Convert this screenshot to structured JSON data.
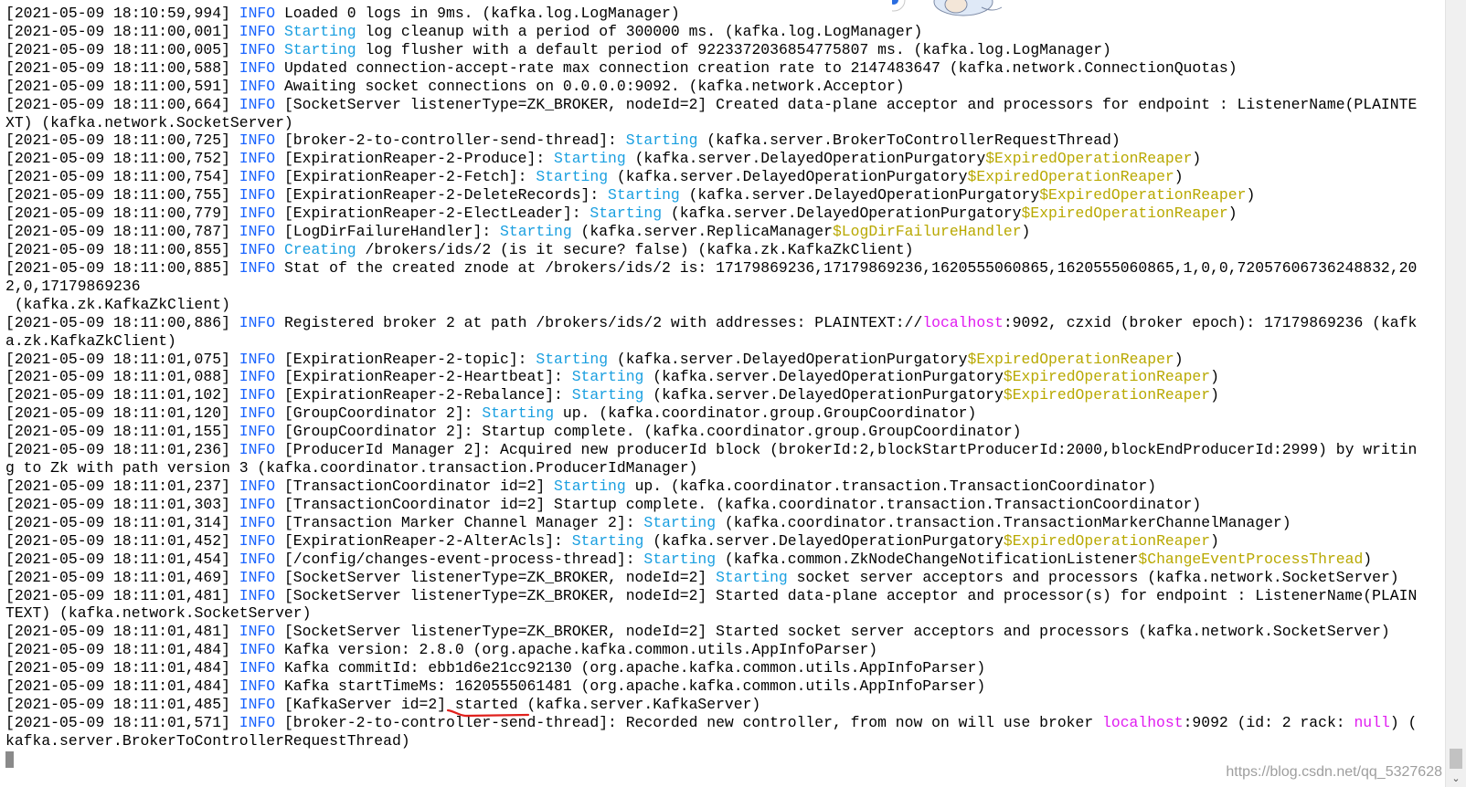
{
  "terminal": {
    "lines": [
      [
        {
          "t": "[2021-05-09 18:10:59,994] "
        },
        {
          "t": "INFO",
          "c": "info"
        },
        {
          "t": " Loaded 0 logs in 9ms. (kafka.log.LogManager)"
        }
      ],
      [
        {
          "t": "[2021-05-09 18:11:00,001] "
        },
        {
          "t": "INFO",
          "c": "info"
        },
        {
          "t": " "
        },
        {
          "t": "Starting",
          "c": "kw"
        },
        {
          "t": " log cleanup with a period of 300000 ms. (kafka.log.LogManager)"
        }
      ],
      [
        {
          "t": "[2021-05-09 18:11:00,005] "
        },
        {
          "t": "INFO",
          "c": "info"
        },
        {
          "t": " "
        },
        {
          "t": "Starting",
          "c": "kw"
        },
        {
          "t": " log flusher with a default period of 9223372036854775807 ms. (kafka.log.LogManager)"
        }
      ],
      [
        {
          "t": "[2021-05-09 18:11:00,588] "
        },
        {
          "t": "INFO",
          "c": "info"
        },
        {
          "t": " Updated connection-accept-rate max connection creation rate to 2147483647 (kafka.network.ConnectionQuotas)"
        }
      ],
      [
        {
          "t": "[2021-05-09 18:11:00,591] "
        },
        {
          "t": "INFO",
          "c": "info"
        },
        {
          "t": " Awaiting socket connections on 0.0.0.0:9092. (kafka.network.Acceptor)"
        }
      ],
      [
        {
          "t": "[2021-05-09 18:11:00,664] "
        },
        {
          "t": "INFO",
          "c": "info"
        },
        {
          "t": " [SocketServer listenerType=ZK_BROKER, nodeId=2] Created data-plane acceptor and processors for endpoint : ListenerName(PLAINTE"
        }
      ],
      [
        {
          "t": "XT) (kafka.network.SocketServer)"
        }
      ],
      [
        {
          "t": "[2021-05-09 18:11:00,725] "
        },
        {
          "t": "INFO",
          "c": "info"
        },
        {
          "t": " [broker-2-to-controller-send-thread]: "
        },
        {
          "t": "Starting",
          "c": "kw"
        },
        {
          "t": " (kafka.server.BrokerToControllerRequestThread)"
        }
      ],
      [
        {
          "t": "[2021-05-09 18:11:00,752] "
        },
        {
          "t": "INFO",
          "c": "info"
        },
        {
          "t": " [ExpirationReaper-2-Produce]: "
        },
        {
          "t": "Starting",
          "c": "kw"
        },
        {
          "t": " (kafka.server.DelayedOperationPurgatory"
        },
        {
          "t": "$ExpiredOperationReaper",
          "c": "hl"
        },
        {
          "t": ")"
        }
      ],
      [
        {
          "t": "[2021-05-09 18:11:00,754] "
        },
        {
          "t": "INFO",
          "c": "info"
        },
        {
          "t": " [ExpirationReaper-2-Fetch]: "
        },
        {
          "t": "Starting",
          "c": "kw"
        },
        {
          "t": " (kafka.server.DelayedOperationPurgatory"
        },
        {
          "t": "$ExpiredOperationReaper",
          "c": "hl"
        },
        {
          "t": ")"
        }
      ],
      [
        {
          "t": "[2021-05-09 18:11:00,755] "
        },
        {
          "t": "INFO",
          "c": "info"
        },
        {
          "t": " [ExpirationReaper-2-DeleteRecords]: "
        },
        {
          "t": "Starting",
          "c": "kw"
        },
        {
          "t": " (kafka.server.DelayedOperationPurgatory"
        },
        {
          "t": "$ExpiredOperationReaper",
          "c": "hl"
        },
        {
          "t": ")"
        }
      ],
      [
        {
          "t": "[2021-05-09 18:11:00,779] "
        },
        {
          "t": "INFO",
          "c": "info"
        },
        {
          "t": " [ExpirationReaper-2-ElectLeader]: "
        },
        {
          "t": "Starting",
          "c": "kw"
        },
        {
          "t": " (kafka.server.DelayedOperationPurgatory"
        },
        {
          "t": "$ExpiredOperationReaper",
          "c": "hl"
        },
        {
          "t": ")"
        }
      ],
      [
        {
          "t": "[2021-05-09 18:11:00,787] "
        },
        {
          "t": "INFO",
          "c": "info"
        },
        {
          "t": " [LogDirFailureHandler]: "
        },
        {
          "t": "Starting",
          "c": "kw"
        },
        {
          "t": " (kafka.server.ReplicaManager"
        },
        {
          "t": "$LogDirFailureHandler",
          "c": "hl"
        },
        {
          "t": ")"
        }
      ],
      [
        {
          "t": "[2021-05-09 18:11:00,855] "
        },
        {
          "t": "INFO",
          "c": "info"
        },
        {
          "t": " "
        },
        {
          "t": "Creating",
          "c": "kw"
        },
        {
          "t": " /brokers/ids/2 (is it secure? false) (kafka.zk.KafkaZkClient)"
        }
      ],
      [
        {
          "t": "[2021-05-09 18:11:00,885] "
        },
        {
          "t": "INFO",
          "c": "info"
        },
        {
          "t": " Stat of the created znode at /brokers/ids/2 is: 17179869236,17179869236,1620555060865,1620555060865,1,0,0,72057606736248832,20"
        }
      ],
      [
        {
          "t": "2,0,17179869236"
        }
      ],
      [
        {
          "t": " (kafka.zk.KafkaZkClient)"
        }
      ],
      [
        {
          "t": "[2021-05-09 18:11:00,886] "
        },
        {
          "t": "INFO",
          "c": "info"
        },
        {
          "t": " Registered broker 2 at path /brokers/ids/2 with addresses: PLAINTEXT://"
        },
        {
          "t": "localhost",
          "c": "mg"
        },
        {
          "t": ":9092, czxid (broker epoch): 17179869236 (kafk"
        }
      ],
      [
        {
          "t": "a.zk.KafkaZkClient)"
        }
      ],
      [
        {
          "t": "[2021-05-09 18:11:01,075] "
        },
        {
          "t": "INFO",
          "c": "info"
        },
        {
          "t": " [ExpirationReaper-2-topic]: "
        },
        {
          "t": "Starting",
          "c": "kw"
        },
        {
          "t": " (kafka.server.DelayedOperationPurgatory"
        },
        {
          "t": "$ExpiredOperationReaper",
          "c": "hl"
        },
        {
          "t": ")"
        }
      ],
      [
        {
          "t": "[2021-05-09 18:11:01,088] "
        },
        {
          "t": "INFO",
          "c": "info"
        },
        {
          "t": " [ExpirationReaper-2-Heartbeat]: "
        },
        {
          "t": "Starting",
          "c": "kw"
        },
        {
          "t": " (kafka.server.DelayedOperationPurgatory"
        },
        {
          "t": "$ExpiredOperationReaper",
          "c": "hl"
        },
        {
          "t": ")"
        }
      ],
      [
        {
          "t": "[2021-05-09 18:11:01,102] "
        },
        {
          "t": "INFO",
          "c": "info"
        },
        {
          "t": " [ExpirationReaper-2-Rebalance]: "
        },
        {
          "t": "Starting",
          "c": "kw"
        },
        {
          "t": " (kafka.server.DelayedOperationPurgatory"
        },
        {
          "t": "$ExpiredOperationReaper",
          "c": "hl"
        },
        {
          "t": ")"
        }
      ],
      [
        {
          "t": "[2021-05-09 18:11:01,120] "
        },
        {
          "t": "INFO",
          "c": "info"
        },
        {
          "t": " [GroupCoordinator 2]: "
        },
        {
          "t": "Starting",
          "c": "kw"
        },
        {
          "t": " up. (kafka.coordinator.group.GroupCoordinator)"
        }
      ],
      [
        {
          "t": "[2021-05-09 18:11:01,155] "
        },
        {
          "t": "INFO",
          "c": "info"
        },
        {
          "t": " [GroupCoordinator 2]: Startup complete. (kafka.coordinator.group.GroupCoordinator)"
        }
      ],
      [
        {
          "t": "[2021-05-09 18:11:01,236] "
        },
        {
          "t": "INFO",
          "c": "info"
        },
        {
          "t": " [ProducerId Manager 2]: Acquired new producerId block (brokerId:2,blockStartProducerId:2000,blockEndProducerId:2999) by writin"
        }
      ],
      [
        {
          "t": "g to Zk with path version 3 (kafka.coordinator.transaction.ProducerIdManager)"
        }
      ],
      [
        {
          "t": "[2021-05-09 18:11:01,237] "
        },
        {
          "t": "INFO",
          "c": "info"
        },
        {
          "t": " [TransactionCoordinator id=2] "
        },
        {
          "t": "Starting",
          "c": "kw"
        },
        {
          "t": " up. (kafka.coordinator.transaction.TransactionCoordinator)"
        }
      ],
      [
        {
          "t": "[2021-05-09 18:11:01,303] "
        },
        {
          "t": "INFO",
          "c": "info"
        },
        {
          "t": " [TransactionCoordinator id=2] Startup complete. (kafka.coordinator.transaction.TransactionCoordinator)"
        }
      ],
      [
        {
          "t": "[2021-05-09 18:11:01,314] "
        },
        {
          "t": "INFO",
          "c": "info"
        },
        {
          "t": " [Transaction Marker Channel Manager 2]: "
        },
        {
          "t": "Starting",
          "c": "kw"
        },
        {
          "t": " (kafka.coordinator.transaction.TransactionMarkerChannelManager)"
        }
      ],
      [
        {
          "t": "[2021-05-09 18:11:01,452] "
        },
        {
          "t": "INFO",
          "c": "info"
        },
        {
          "t": " [ExpirationReaper-2-AlterAcls]: "
        },
        {
          "t": "Starting",
          "c": "kw"
        },
        {
          "t": " (kafka.server.DelayedOperationPurgatory"
        },
        {
          "t": "$ExpiredOperationReaper",
          "c": "hl"
        },
        {
          "t": ")"
        }
      ],
      [
        {
          "t": "[2021-05-09 18:11:01,454] "
        },
        {
          "t": "INFO",
          "c": "info"
        },
        {
          "t": " [/config/changes-event-process-thread]: "
        },
        {
          "t": "Starting",
          "c": "kw"
        },
        {
          "t": " (kafka.common.ZkNodeChangeNotificationListener"
        },
        {
          "t": "$ChangeEventProcessThread",
          "c": "hl"
        },
        {
          "t": ")"
        }
      ],
      [
        {
          "t": "[2021-05-09 18:11:01,469] "
        },
        {
          "t": "INFO",
          "c": "info"
        },
        {
          "t": " [SocketServer listenerType=ZK_BROKER, nodeId=2] "
        },
        {
          "t": "Starting",
          "c": "kw"
        },
        {
          "t": " socket server acceptors and processors (kafka.network.SocketServer)"
        }
      ],
      [
        {
          "t": "[2021-05-09 18:11:01,481] "
        },
        {
          "t": "INFO",
          "c": "info"
        },
        {
          "t": " [SocketServer listenerType=ZK_BROKER, nodeId=2] Started data-plane acceptor and processor(s) for endpoint : ListenerName(PLAIN"
        }
      ],
      [
        {
          "t": "TEXT) (kafka.network.SocketServer)"
        }
      ],
      [
        {
          "t": "[2021-05-09 18:11:01,481] "
        },
        {
          "t": "INFO",
          "c": "info"
        },
        {
          "t": " [SocketServer listenerType=ZK_BROKER, nodeId=2] Started socket server acceptors and processors (kafka.network.SocketServer)"
        }
      ],
      [
        {
          "t": "[2021-05-09 18:11:01,484] "
        },
        {
          "t": "INFO",
          "c": "info"
        },
        {
          "t": " Kafka version: 2.8.0 (org.apache.kafka.common.utils.AppInfoParser)"
        }
      ],
      [
        {
          "t": "[2021-05-09 18:11:01,484] "
        },
        {
          "t": "INFO",
          "c": "info"
        },
        {
          "t": " Kafka commitId: ebb1d6e21cc92130 (org.apache.kafka.common.utils.AppInfoParser)"
        }
      ],
      [
        {
          "t": "[2021-05-09 18:11:01,484] "
        },
        {
          "t": "INFO",
          "c": "info"
        },
        {
          "t": " Kafka startTimeMs: 1620555061481 (org.apache.kafka.common.utils.AppInfoParser)"
        }
      ],
      [
        {
          "t": "[2021-05-09 18:11:01,485] "
        },
        {
          "t": "INFO",
          "c": "info"
        },
        {
          "t": " [KafkaServer id=2] started (kafka.server.KafkaServer)"
        }
      ],
      [
        {
          "t": "[2021-05-09 18:11:01,571] "
        },
        {
          "t": "INFO",
          "c": "info"
        },
        {
          "t": " [broker-2-to-controller-send-thread]: Recorded new controller, from now on will use broker "
        },
        {
          "t": "localhost",
          "c": "mg"
        },
        {
          "t": ":9092 (id: 2 rack: "
        },
        {
          "t": "null",
          "c": "mg"
        },
        {
          "t": ") ("
        }
      ],
      [
        {
          "t": "kafka.server.BrokerToControllerRequestThread)"
        }
      ]
    ]
  },
  "watermark": "https://blog.csdn.net/qq_5327628",
  "colors": {
    "info": "#1a64ff",
    "keyword": "#1a9fe0",
    "inner_class": "#b8a800",
    "host_null": "#e01cf0",
    "annotation": "#e0201c"
  },
  "icons": {
    "scroll_down": "chevron-down-icon"
  }
}
